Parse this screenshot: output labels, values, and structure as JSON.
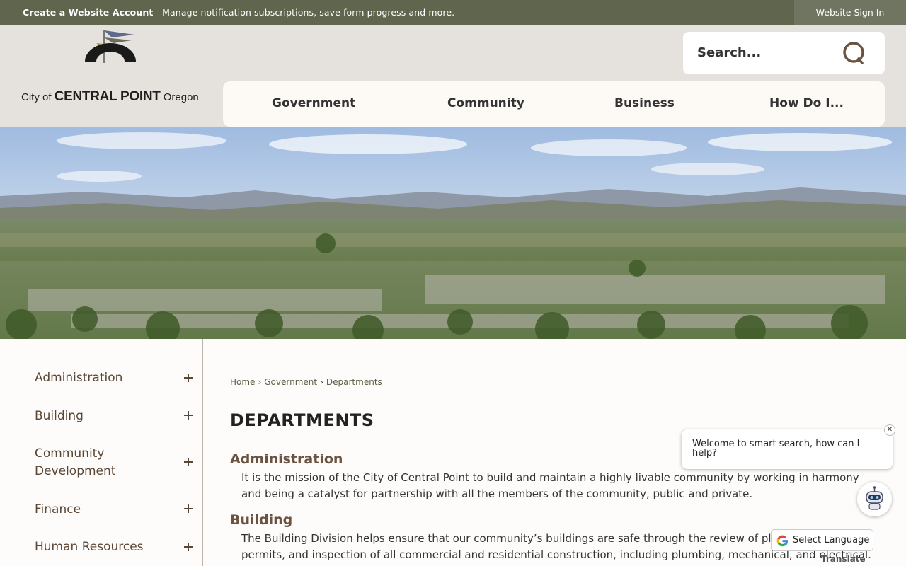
{
  "topbar": {
    "account_link": "Create a Website Account",
    "account_desc": " - Manage notification subscriptions, save form progress and more.",
    "signin": "Website Sign In"
  },
  "logo": {
    "prefix": "City of ",
    "name": "CENTRAL POINT",
    "suffix": " Oregon"
  },
  "search": {
    "placeholder": "Search..."
  },
  "nav": {
    "items": [
      "Government",
      "Community",
      "Business",
      "How Do I..."
    ]
  },
  "sidebar": {
    "items": [
      "Administration",
      "Building",
      "Community Development",
      "Finance",
      "Human Resources"
    ]
  },
  "breadcrumb": {
    "items": [
      "Home",
      "Government",
      "Departments"
    ]
  },
  "main": {
    "title": "DEPARTMENTS",
    "sections": [
      {
        "heading": "Administration",
        "body": "It is the mission of the City of Central Point to build and maintain a highly livable community by working in harmony and being a catalyst for partnership with all the members of the community, public and private."
      },
      {
        "heading": "Building",
        "body": "The Building Division helps ensure that our community’s buildings are safe through the review of plans, issuance of permits, and inspection of all commercial and residential construction, including plumbing, mechanical, and electrical."
      }
    ]
  },
  "chat": {
    "message": "Welcome to smart search, how can I help?",
    "close": "✕"
  },
  "translate": {
    "label": "Select Language",
    "powered": "Translate"
  },
  "colors": {
    "topbar": "#5f664d",
    "header": "#e5e1dc",
    "accent_brown": "#6b5341"
  }
}
